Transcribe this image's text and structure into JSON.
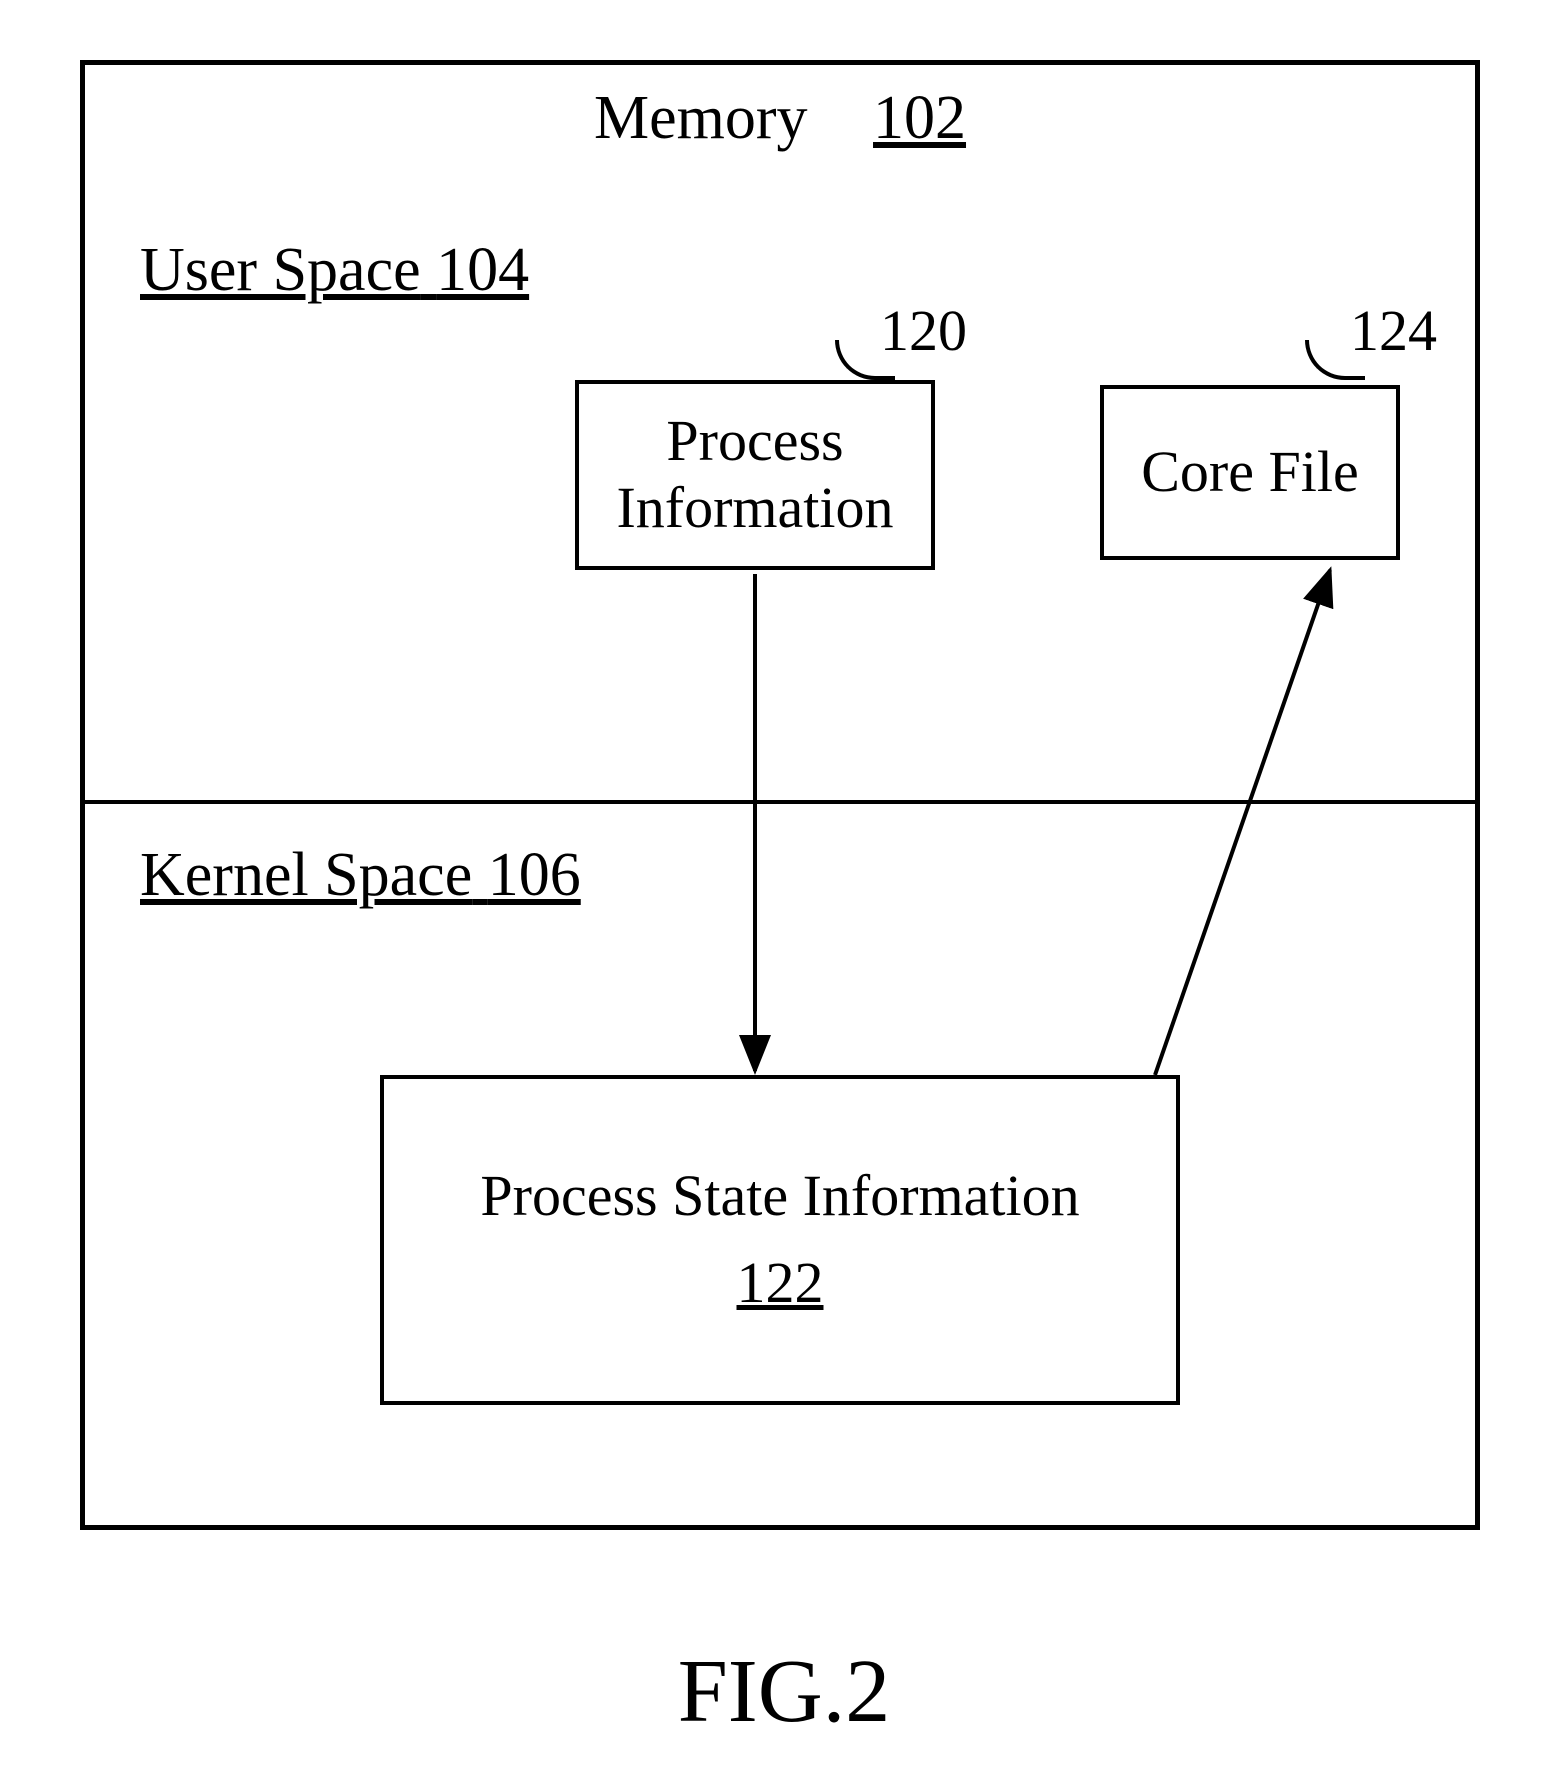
{
  "title": {
    "text": "Memory",
    "ref": "102"
  },
  "sections": {
    "user": {
      "label": "User Space",
      "ref": "104"
    },
    "kernel": {
      "label": "Kernel Space",
      "ref": "106"
    }
  },
  "boxes": {
    "procInfo": {
      "label_line1": "Process",
      "label_line2": "Information",
      "ref": "120"
    },
    "coreFile": {
      "label": "Core File",
      "ref": "124"
    },
    "procState": {
      "label": "Process State Information",
      "ref": "122"
    }
  },
  "figure": "FIG.2"
}
